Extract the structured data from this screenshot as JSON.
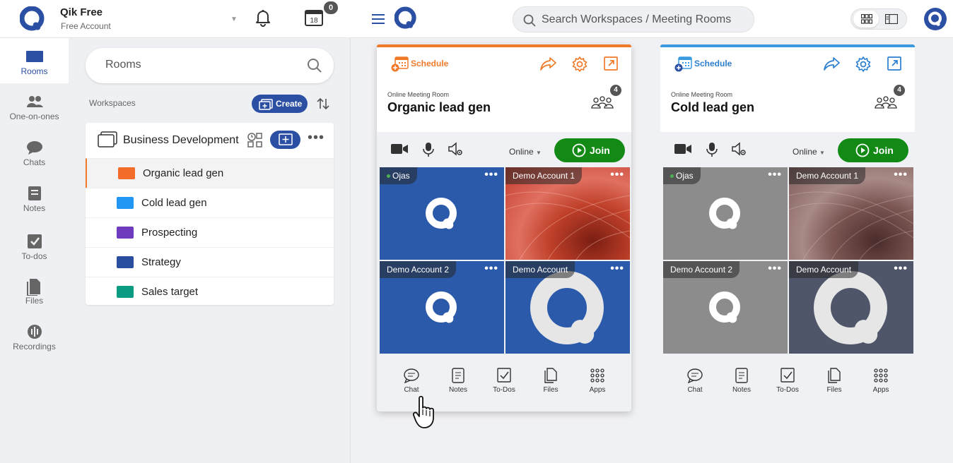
{
  "colors": {
    "brand": "#2b4fa3",
    "join": "#138a16",
    "orange": "#f07a2a",
    "blue": "#3a9ae0"
  },
  "account": {
    "name": "Qik Free",
    "type": "Free Account",
    "calendar_day": "18",
    "notifications": "0"
  },
  "nav": [
    {
      "label": "Rooms",
      "icon": "rooms-icon",
      "active": true
    },
    {
      "label": "One-on-ones",
      "icon": "people-icon"
    },
    {
      "label": "Chats",
      "icon": "chat-icon"
    },
    {
      "label": "Notes",
      "icon": "notes-icon"
    },
    {
      "label": "To-dos",
      "icon": "todo-icon"
    },
    {
      "label": "Files",
      "icon": "files-icon"
    },
    {
      "label": "Recordings",
      "icon": "recordings-icon"
    }
  ],
  "rooms_panel": {
    "search_placeholder": "Rooms",
    "workspaces_label": "Workspaces",
    "create_label": "Create",
    "workspace": {
      "name": "Business Development",
      "rooms": [
        {
          "name": "Organic lead gen",
          "color": "#f36c2a",
          "active": true
        },
        {
          "name": "Cold lead gen",
          "color": "#2196f3"
        },
        {
          "name": "Prospecting",
          "color": "#6f3cc0"
        },
        {
          "name": "Strategy",
          "color": "#2a4fa0"
        },
        {
          "name": "Sales target",
          "color": "#0a9b82"
        }
      ]
    }
  },
  "main": {
    "search_placeholder": "Search Workspaces / Meeting Rooms"
  },
  "cards": [
    {
      "schedule_label": "Schedule",
      "room_type": "Online Meeting Room",
      "title": "Organic lead gen",
      "participants": "4",
      "status": "Online",
      "join_label": "Join",
      "tiles": [
        "Ojas",
        "Demo Account 1",
        "Demo Account 2",
        "Demo Account"
      ]
    },
    {
      "schedule_label": "Schedule",
      "room_type": "Online Meeting Room",
      "title": "Cold lead gen",
      "participants": "4",
      "status": "Online",
      "join_label": "Join",
      "tiles": [
        "Ojas",
        "Demo Account 1",
        "Demo Account 2",
        "Demo Account"
      ]
    }
  ],
  "toolbar": [
    "Chat",
    "Notes",
    "To-Dos",
    "Files",
    "Apps"
  ]
}
